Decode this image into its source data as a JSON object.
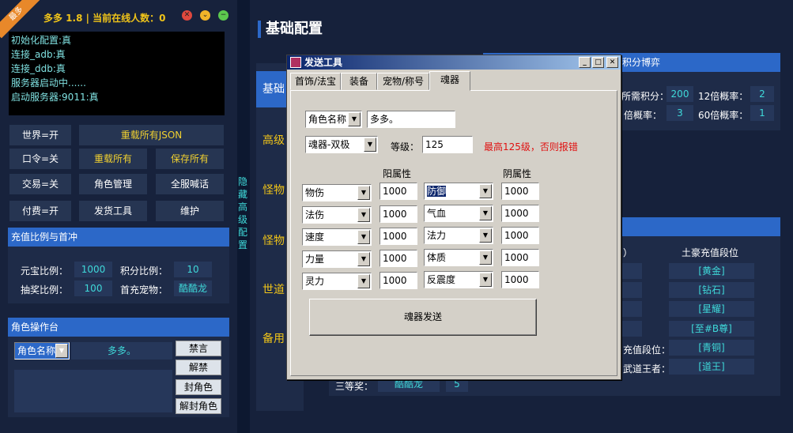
{
  "left": {
    "ribbon": "最多",
    "title": "多多 1.8 | 当前在线人数：0",
    "console": [
      "初始化配置:真",
      "连接_adb:真",
      "连接_ddb:真",
      "服务器启动中......",
      "启动服务器:9011:真"
    ],
    "buttons": {
      "world": "世界=开",
      "reload_json": "重载所有JSON",
      "password": "口令=关",
      "reload_all": "重载所有",
      "save_all": "保存所有",
      "trade": "交易=关",
      "role_mgmt": "角色管理",
      "server_shout": "全服喊话",
      "pay": "付费=开",
      "send_tool": "发货工具",
      "maintain": "维护"
    },
    "recharge": {
      "header": "充值比例与首冲",
      "yuanbao_label": "元宝比例：",
      "yuanbao": "1000",
      "points_label": "积分比例：",
      "points": "10",
      "lottery_label": "抽奖比例：",
      "lottery": "100",
      "pet_label": "首充宠物：",
      "pet": "酷酷龙"
    },
    "roleops": {
      "header": "角色操作台",
      "select": "角色名称",
      "name": "多多。",
      "mute": "禁言",
      "unmute": "解禁",
      "ban": "封角色",
      "unban": "解封角色"
    }
  },
  "vertical_label": "隐藏高级配置",
  "main": {
    "title": "基础配置",
    "tabs": [
      "基础",
      "高级",
      "怪物",
      "怪物",
      "世道",
      "备用"
    ],
    "panel1": {
      "header": "积分博弈",
      "need_label": "所需积分：",
      "need": "200",
      "x12_label": "12倍概率：",
      "x12": "2",
      "rate_label": "倍概率：",
      "rate": "3",
      "x60_label": "60倍概率：",
      "x60": "1"
    },
    "panel2": {
      "col1": "）",
      "col2": "土豪充值段位",
      "ranks": [
        "[黄金]",
        "[钻石]",
        "[星耀]",
        "[至#B尊]"
      ],
      "rank_label": "充值段位：",
      "rank_val": "[青铜]",
      "king_label": "武道王者：",
      "king_val": "[道王]",
      "third_label": "三等奖：",
      "third_pet": "酷酷龙",
      "third_num": "5"
    }
  },
  "dialog": {
    "title": "发送工具",
    "tabs": [
      "首饰/法宝",
      "装备",
      "宠物/称号",
      "魂器"
    ],
    "role_select": "角色名称",
    "role_name": "多多。",
    "type_select": "魂器-双极",
    "level_label": "等级：",
    "level": "125",
    "level_warn": "最高125级，否则报错",
    "yang_header": "阳属性",
    "yin_header": "阴属性",
    "yang": [
      {
        "attr": "物伤",
        "value": "1000"
      },
      {
        "attr": "法伤",
        "value": "1000"
      },
      {
        "attr": "速度",
        "value": "1000"
      },
      {
        "attr": "力量",
        "value": "1000"
      },
      {
        "attr": "灵力",
        "value": "1000"
      }
    ],
    "yin": [
      {
        "attr": "防御",
        "value": "1000"
      },
      {
        "attr": "气血",
        "value": "1000"
      },
      {
        "attr": "法力",
        "value": "1000"
      },
      {
        "attr": "体质",
        "value": "1000"
      },
      {
        "attr": "反震度",
        "value": "1000"
      }
    ],
    "send_button": "魂器发送"
  },
  "colors": {
    "accent": "#2c68c8",
    "cyan": "#3fd9d9",
    "yellow": "#f0c419",
    "warn": "#e01010"
  }
}
